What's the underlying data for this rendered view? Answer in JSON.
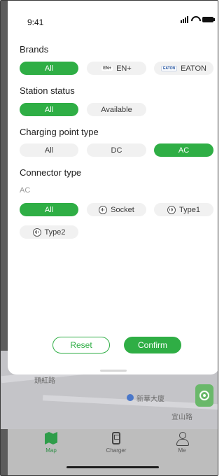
{
  "status_bar": {
    "time": "9:41"
  },
  "filters": {
    "brands": {
      "title": "Brands",
      "options": [
        {
          "label": "All",
          "selected": true
        },
        {
          "label": "EN+",
          "logo": "EN+",
          "selected": false
        },
        {
          "label": "EATON",
          "logo": "EATON",
          "selected": false
        }
      ]
    },
    "station_status": {
      "title": "Station status",
      "options": [
        {
          "label": "All",
          "selected": true
        },
        {
          "label": "Available",
          "selected": false
        }
      ]
    },
    "charging_point_type": {
      "title": "Charging point type",
      "options": [
        {
          "label": "All",
          "selected": false
        },
        {
          "label": "DC",
          "selected": false
        },
        {
          "label": "AC",
          "selected": true
        }
      ]
    },
    "connector_type": {
      "title": "Connector type",
      "group_label": "AC",
      "options": [
        {
          "label": "All",
          "selected": true
        },
        {
          "label": "Socket",
          "icon": "socket-icon",
          "selected": false
        },
        {
          "label": "Type1",
          "icon": "type1-connector-icon",
          "selected": false
        },
        {
          "label": "Type2",
          "icon": "type2-connector-icon",
          "selected": false
        }
      ]
    }
  },
  "actions": {
    "reset_label": "Reset",
    "confirm_label": "Confirm"
  },
  "map": {
    "labels": [
      "頭紅路",
      "新華大廈",
      "宜山路"
    ]
  },
  "tabbar": {
    "items": [
      {
        "label": "Map",
        "icon": "map-icon",
        "active": true
      },
      {
        "label": "Charger",
        "icon": "charger-icon",
        "active": false
      },
      {
        "label": "Me",
        "icon": "person-icon",
        "active": false
      }
    ]
  },
  "colors": {
    "accent": "#2fae45",
    "chip_bg": "#f1f1f1",
    "muted_text": "#9a9a9a"
  }
}
